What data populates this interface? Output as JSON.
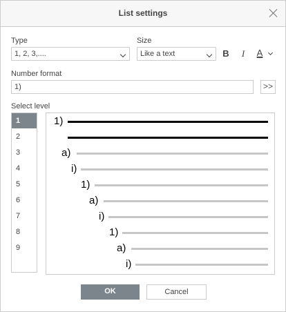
{
  "dialog": {
    "title": "List settings"
  },
  "type": {
    "label": "Type",
    "value": "1, 2, 3,...."
  },
  "size": {
    "label": "Size",
    "value": "Like a text"
  },
  "format_buttons": {
    "bold": "B",
    "italic": "I",
    "color": "A"
  },
  "colors": {
    "font_color": "#000000",
    "accent": "#7d858c"
  },
  "number_format": {
    "label": "Number format",
    "value": "1)",
    "more_label": ">>"
  },
  "select_level": {
    "label": "Select level",
    "selected": "1",
    "levels": [
      "1",
      "2",
      "3",
      "4",
      "5",
      "6",
      "7",
      "8",
      "9"
    ]
  },
  "preview": {
    "rows": [
      {
        "marker": "1)",
        "active": true
      },
      {
        "marker": "",
        "active": true
      },
      {
        "marker": "a)",
        "active": false
      },
      {
        "marker": "i)",
        "active": false
      },
      {
        "marker": "1)",
        "active": false
      },
      {
        "marker": "a)",
        "active": false
      },
      {
        "marker": "i)",
        "active": false
      },
      {
        "marker": "1)",
        "active": false
      },
      {
        "marker": "a)",
        "active": false
      },
      {
        "marker": "i)",
        "active": false
      }
    ]
  },
  "buttons": {
    "ok": "OK",
    "cancel": "Cancel"
  }
}
